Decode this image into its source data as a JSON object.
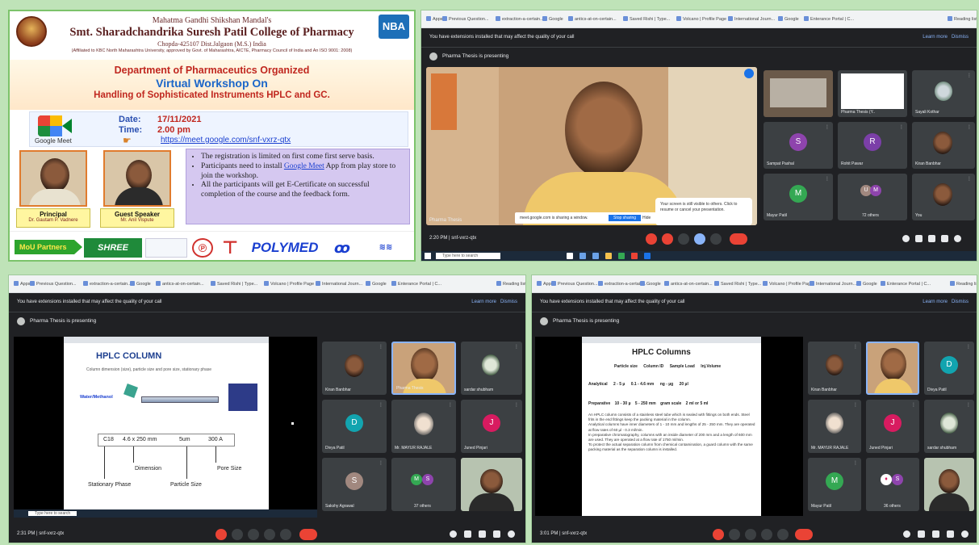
{
  "flyer": {
    "mandal": "Mahatma Gandhi Shikshan Mandal's",
    "college": "Smt. Sharadchandrika Suresh Patil College of Pharmacy",
    "address": "Chopda-425107 Dist.Jalgaon (M.S.) India",
    "affiliation": "(Affiliated to KBC North Maharashtra University, approved by Govt. of Maharashtra, AICTE, Pharmacy Council of India and An ISO 9001: 2008)",
    "accreditation_logo": "NBA",
    "department": "Department of Pharmaceutics Organized",
    "event": "Virtual Workshop On",
    "topic": "Handling of Sophisticated Instruments  HPLC and GC.",
    "meet_logo_label": "Google Meet",
    "date_label": "Date:",
    "date_value": "17/11/2021",
    "time_label": "Time:",
    "time_value": "2.00 pm",
    "meet_link": "https://meet.google.com/snf-vxrz-qtx",
    "principal": {
      "role": "Principal",
      "name": "Dr. Gautam P. Vadnere"
    },
    "speaker": {
      "role": "Guest Speaker",
      "name": "Mr. Anil Vispute"
    },
    "bullets": [
      {
        "pre": "The registration is limited on first come first serve basis.",
        "link": "",
        "post": ""
      },
      {
        "pre": "Participants need to install ",
        "link": "Google Meet",
        "post": " App from play store to join the workshop."
      },
      {
        "pre": "All the participants will get E-Certificate on successful completion of the course and the feedback form.",
        "link": "",
        "post": ""
      }
    ],
    "mou_label": "MoU Partners",
    "partners": [
      "SHREE",
      "POLYMED"
    ]
  },
  "meet": {
    "extensions_msg": "You have extensions installed that may affect the quality of your call",
    "learn_more": "Learn more",
    "dismiss": "Dismiss",
    "presenting": "Pharma Thesis is presenting",
    "bookmarks": [
      "Apps",
      "Previous Question...",
      "extraction-a-certain...",
      "Google",
      "antics-at-on-certain...",
      "Saved Rishi | Type...",
      "Volcano | Profile Page",
      "International Journ...",
      "Google",
      "Enterance Portal | C..."
    ],
    "reading_list": "Reading list",
    "screen_share_notice": "Your screen is still visible to others. Click to resume or cancel your presentation.",
    "share_bar_text": "meet.google.com is sharing a window.",
    "stop_sharing": "Stop sharing",
    "hide": "Hide",
    "taskbar_search": "Type here to search",
    "windows": [
      {
        "clock": "2:20 PM  |  snf-vxrz-qtx",
        "main_label": "Pharma Thesis",
        "tiles": [
          {
            "name": "Pharma Thesis (Y..",
            "type": "screen"
          },
          {
            "name": "Sayali Kothar",
            "type": "photo"
          },
          {
            "name": "Sampat Pashal",
            "type": "avatar",
            "letter": "S",
            "color": "#8e44ad"
          },
          {
            "name": "Rohit Pawar",
            "type": "avatar",
            "letter": "R",
            "color": "#7b3fa8"
          },
          {
            "name": "Kiran Banbhar",
            "type": "photo"
          },
          {
            "name": "Mayur Patil",
            "type": "avatar",
            "letter": "M",
            "color": "#34a853"
          },
          {
            "name": "72 others",
            "type": "others"
          },
          {
            "name": "You",
            "type": "photo"
          }
        ]
      },
      {
        "clock": "2:31 PM  |  snf-vxrz-qtx",
        "slide_title": "HPLC COLUMN",
        "slide_subtitle": "Column dimension (size), particle size and pore size, stationary phase",
        "slide_inlet": "Water/Methanol",
        "slide_spec": [
          "C18",
          "4.6 x 250 mm",
          "5um",
          "300 A"
        ],
        "slide_labels": [
          "Dimension",
          "Pore Size",
          "Stationary Phase",
          "Particle Size"
        ],
        "tiles": [
          {
            "name": "Kiran Banbhar",
            "type": "photo"
          },
          {
            "name": "Pharma Thesis",
            "type": "photo"
          },
          {
            "name": "sardar shubham",
            "type": "photo"
          },
          {
            "name": "Divya Patil",
            "type": "avatar",
            "letter": "D",
            "color": "#12a4af"
          },
          {
            "name": "Mr. MAYUR RAJALE",
            "type": "photo"
          },
          {
            "name": "Juned Pinjari",
            "type": "avatar",
            "letter": "J",
            "color": "#d81b60"
          },
          {
            "name": "Sakshy Agrawal",
            "type": "avatar",
            "letter": "S",
            "color": "#a1887f"
          },
          {
            "name": "37 others",
            "type": "others"
          },
          {
            "name": "",
            "type": "photo"
          }
        ]
      },
      {
        "clock": "3:01 PM  |  snf-vxrz-qtx",
        "slide_title": "HPLC Columns",
        "slide_table_head": [
          "Particle size",
          "Column ID",
          "Sample Load",
          "Inj.Volume"
        ],
        "slide_row1": [
          "Analytical",
          "2 - 5 µ",
          "0.1 - 4.6 mm",
          "ng - µg",
          "20 µl"
        ],
        "slide_row2": [
          "Preparative",
          "10 - 30 µ",
          "5 - 250 mm",
          "gram scale",
          "2 ml or 5 ml"
        ],
        "slide_points": [
          "An HPLC column consists of a stainless steel tube which is sealed with fittings on both ends. Steel frits in the end fittings keep the packing material in the column.",
          "Analytical columns have inner diameters of 1 - 10 mm and lengths of 25 - 250 mm. They are operated at flow rates of 60 µl - 0.3 ml/min.",
          "In preparative chromatography, columns with an inside diameter of 200 mm and a length of 600 mm are used. They are operated at a flow rate of 1750 ml/min.",
          "To protect the actual separation column from chemical contamination, a guard column with the same packing material as the separation column is installed."
        ],
        "tiles": [
          {
            "name": "Kiran Banbhar",
            "type": "photo"
          },
          {
            "name": "Pharma Thesis",
            "type": "photo"
          },
          {
            "name": "Divya Patil",
            "type": "avatar",
            "letter": "D",
            "color": "#12a4af"
          },
          {
            "name": "Mr. MAYUR RAJALE",
            "type": "photo"
          },
          {
            "name": "Juned Pinjari",
            "type": "avatar",
            "letter": "J",
            "color": "#d81b60"
          },
          {
            "name": "sardar shubham",
            "type": "photo"
          },
          {
            "name": "Mayur Patil",
            "type": "avatar",
            "letter": "M",
            "color": "#34a853"
          },
          {
            "name": "36 others",
            "type": "others"
          },
          {
            "name": "",
            "type": "photo"
          }
        ]
      }
    ]
  }
}
